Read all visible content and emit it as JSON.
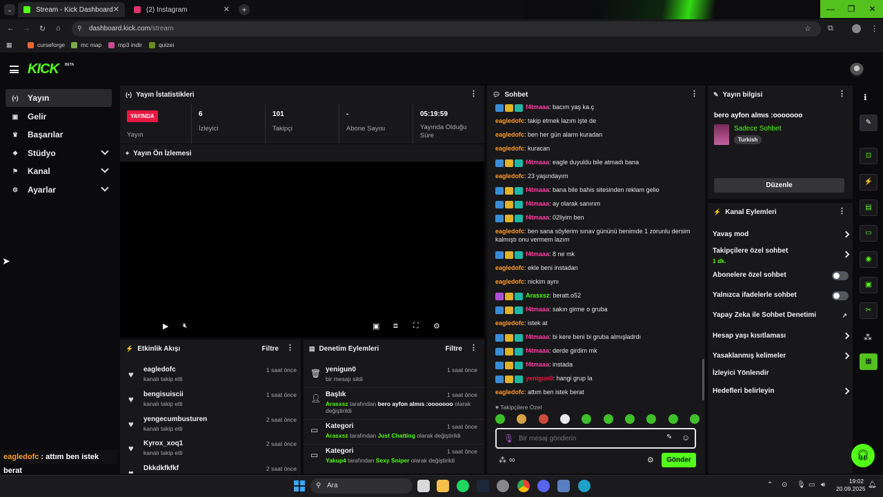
{
  "browser": {
    "tabs": [
      {
        "title": "Stream - Kick Dashboard",
        "icon_color": "#53fc18"
      },
      {
        "title": "(2) Instagram",
        "icon_color": "#e1306c"
      }
    ],
    "url_host": "dashboard.kick.com",
    "url_path": "/stream",
    "bookmarks": [
      {
        "label": "curseforge",
        "color": "#f16436"
      },
      {
        "label": "mc map",
        "color": "#7aa84a"
      },
      {
        "label": "mp3 indir",
        "color": "#c94b8f"
      },
      {
        "label": "quizei",
        "color": "#6b8e23"
      }
    ]
  },
  "header": {
    "logo": "KICK",
    "beta": "BETA"
  },
  "sidebar": {
    "items": [
      {
        "label": "Yayın",
        "icon": "broadcast-icon",
        "glyph": "(•)"
      },
      {
        "label": "Gelir",
        "icon": "wallet-icon",
        "glyph": "▣"
      },
      {
        "label": "Başarılar",
        "icon": "trophy-icon",
        "glyph": "♛"
      },
      {
        "label": "Stüdyo",
        "icon": "studio-icon",
        "glyph": "❖"
      },
      {
        "label": "Kanal",
        "icon": "channel-icon",
        "glyph": "⚑"
      },
      {
        "label": "Ayarlar",
        "icon": "gear-icon",
        "glyph": "⚙"
      }
    ]
  },
  "stats": {
    "title": "Yayın İstatistikleri",
    "live_badge": "YAYINDA",
    "cells": [
      {
        "value": "",
        "label": "Yayın"
      },
      {
        "value": "6",
        "label": "İzleyici"
      },
      {
        "value": "101",
        "label": "Takipçi"
      },
      {
        "value": "-",
        "label": "Abone Sayısı"
      },
      {
        "value": "05:19:59",
        "label": "Yayında Olduğu Süre"
      }
    ]
  },
  "preview": {
    "title": "Yayın Ön İzlemesi"
  },
  "activity": {
    "title": "Etkinlik Akışı",
    "filter": "Filtre",
    "items": [
      {
        "name": "eagledofc",
        "sub": "kanalı takip etti",
        "time": "1 saat önce"
      },
      {
        "name": "bengisuiscii",
        "sub": "kanalı takip etti",
        "time": "1 saat önce"
      },
      {
        "name": "yengecumbusturen",
        "sub": "kanalı takip etti",
        "time": "2 saat önce"
      },
      {
        "name": "Kyrox_xoq1",
        "sub": "kanalı takip etti",
        "time": "2 saat önce"
      },
      {
        "name": "Dkkdkfkfkf",
        "sub": "",
        "time": "2 saat önce"
      }
    ]
  },
  "moderation": {
    "title": "Denetim Eylemleri",
    "filter": "Filtre",
    "items": [
      {
        "name": "yenigun0",
        "pre": "",
        "mid": "bir mesajı sildi",
        "bold": "",
        "post": "",
        "time": "1 saat önce"
      },
      {
        "name": "Başlık",
        "pre": "Arasxsz",
        "mid": " tarafından ",
        "bold": "bero ayfon almıs :ooooooo",
        "post": " olarak değiştirildi",
        "time": "1 saat önce"
      },
      {
        "name": "Kategori",
        "pre": "Arasxsz",
        "mid": " tarafından ",
        "bold": "Just Chatting",
        "post": " olarak değiştirildi",
        "time": "1 saat önce"
      },
      {
        "name": "Kategori",
        "pre": "Yakup4",
        "mid": " tarafından ",
        "bold": "Sexy Sniper",
        "post": " olarak değiştirildi",
        "time": "1 saat önce"
      }
    ]
  },
  "chat": {
    "title": "Sohbet",
    "messages": [
      {
        "user": "f4tmaaa",
        "cls": "u-f4t",
        "badges": true,
        "text": "bacım yaş ka.ç"
      },
      {
        "user": "eagledofc",
        "cls": "u-eagle",
        "badges": false,
        "text": "takip etmek lazım işte de"
      },
      {
        "user": "eagledofc",
        "cls": "u-eagle",
        "badges": false,
        "text": "ben her gün alarm kuradan"
      },
      {
        "user": "eagledofc",
        "cls": "u-eagle",
        "badges": false,
        "text": "kuracan"
      },
      {
        "user": "f4tmaaa",
        "cls": "u-f4t",
        "badges": true,
        "text": "eagle duyuldu bile atmadı bana"
      },
      {
        "user": "eagledofc",
        "cls": "u-eagle",
        "badges": false,
        "text": "23 yaşındayım"
      },
      {
        "user": "f4tmaaa",
        "cls": "u-f4t",
        "badges": true,
        "text": "bana bile bahis sitesinden reklam gelio"
      },
      {
        "user": "f4tmaaa",
        "cls": "u-f4t",
        "badges": true,
        "text": "ay olarak sanırım"
      },
      {
        "user": "f4tmaaa",
        "cls": "u-f4t",
        "badges": true,
        "text": "02liyim ben"
      },
      {
        "user": "eagledofc",
        "cls": "u-eagle",
        "badges": false,
        "text": "ben sana söylerim sınav gününü benimde 1 zorunlu dersim kalmıştı onu vermem lazım"
      },
      {
        "user": "f4tmaaa",
        "cls": "u-f4t",
        "badges": true,
        "text": "8 ne mk"
      },
      {
        "user": "eagledofc",
        "cls": "u-eagle",
        "badges": false,
        "text": "ekle beni instadan"
      },
      {
        "user": "eagledofc",
        "cls": "u-eagle",
        "badges": false,
        "text": "nickim aynı"
      },
      {
        "user": "Arasxsz",
        "cls": "u-ara",
        "badges": true,
        "text": "beratt.o52"
      },
      {
        "user": "f4tmaaa",
        "cls": "u-f4t",
        "badges": true,
        "text": "sakın girme o gruba"
      },
      {
        "user": "eagledofc",
        "cls": "u-eagle",
        "badges": false,
        "text": "istek at"
      },
      {
        "user": "f4tmaaa",
        "cls": "u-f4t",
        "badges": true,
        "text": "bi kere beni bi gruba almışladrdı"
      },
      {
        "user": "f4tmaaa",
        "cls": "u-f4t",
        "badges": true,
        "text": "derde girdim mk"
      },
      {
        "user": "f4tmaaa",
        "cls": "u-f4t",
        "badges": true,
        "text": "instada"
      },
      {
        "user": "yenigun0",
        "cls": "u-yen",
        "badges": true,
        "text": "hangi grup la"
      },
      {
        "user": "eagledofc",
        "cls": "u-eagle",
        "badges": false,
        "text": "attım ben istek berat"
      }
    ],
    "followers_only": "Takipçilere Özel",
    "placeholder": "Bir mesaj gönderin",
    "send": "Gönder"
  },
  "overlay": {
    "user": "eagledofc",
    "text": " : attım ben istek berat"
  },
  "stream_info": {
    "title": "Yayın bilgisi",
    "stream_title": "bero ayfon almıs :ooooooo",
    "category": "Sadece Sohbet",
    "tag": "Turkish",
    "edit": "Düzenle"
  },
  "channel_actions": {
    "title": "Kanal Eylemleri",
    "items": [
      {
        "label": "Yavaş mod",
        "kind": "chev"
      },
      {
        "label": "Takipçilere özel sohbet",
        "sub": "1 dk.",
        "kind": "chev"
      },
      {
        "label": "Abonelere özel sohbet",
        "kind": "toggle"
      },
      {
        "label": "Yalnızca ifadelerle sohbet",
        "kind": "toggle"
      },
      {
        "label": "Yapay Zeka ile Sohbet Denetimi",
        "kind": "ext"
      },
      {
        "label": "Hesap yaşı kısıtlaması",
        "kind": "chev"
      },
      {
        "label": "Yasaklanmış kelimeler",
        "kind": "chev"
      },
      {
        "label": "İzleyici Yönlendir",
        "kind": "none"
      },
      {
        "label": "Hedefleri belirleyin",
        "kind": "chev"
      }
    ]
  },
  "taskbar": {
    "search": "Ara",
    "time": "19:02",
    "date": "20.09.2025"
  }
}
